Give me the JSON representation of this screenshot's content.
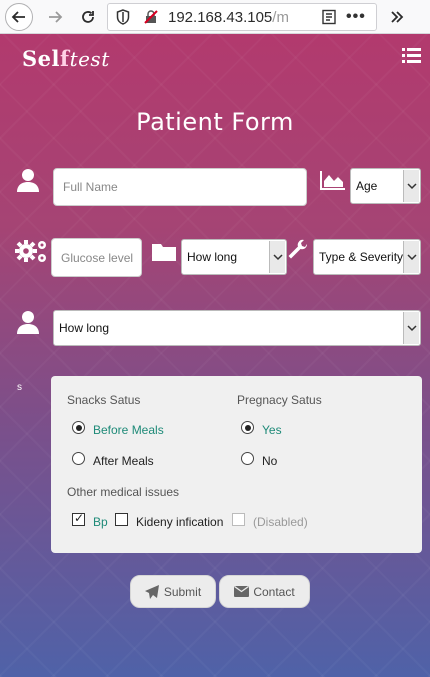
{
  "browser": {
    "url_main": "192.168.43.105",
    "url_rest": "/mc",
    "more": "•••"
  },
  "header": {
    "logo_self": "Sel",
    "logo_f": "f",
    "logo_test": "test"
  },
  "form": {
    "title": "Patient Form",
    "full_name_placeholder": "Full Name",
    "age_select": "Age",
    "glucose_placeholder": "Glucose level",
    "how_long_select": "How long",
    "type_severity_select": "Type & Severity",
    "how_long_select_2": "How long",
    "s_label": "s"
  },
  "panel": {
    "snacks_label": "Snacks Satus",
    "snacks_options": [
      "Before Meals",
      "After Meals"
    ],
    "pregnancy_label": "Pregnacy Satus",
    "pregnancy_options": [
      "Yes",
      "No"
    ],
    "other_label": "Other medical issues",
    "issues": [
      "Bp",
      "Kideny infication",
      "(Disabled)"
    ]
  },
  "buttons": {
    "submit": "Submit",
    "contact": "Contact"
  },
  "colors": {
    "selected_option": "#1e8a78",
    "gradient_top": "#b23a6e",
    "gradient_bottom": "#4f62a8"
  }
}
